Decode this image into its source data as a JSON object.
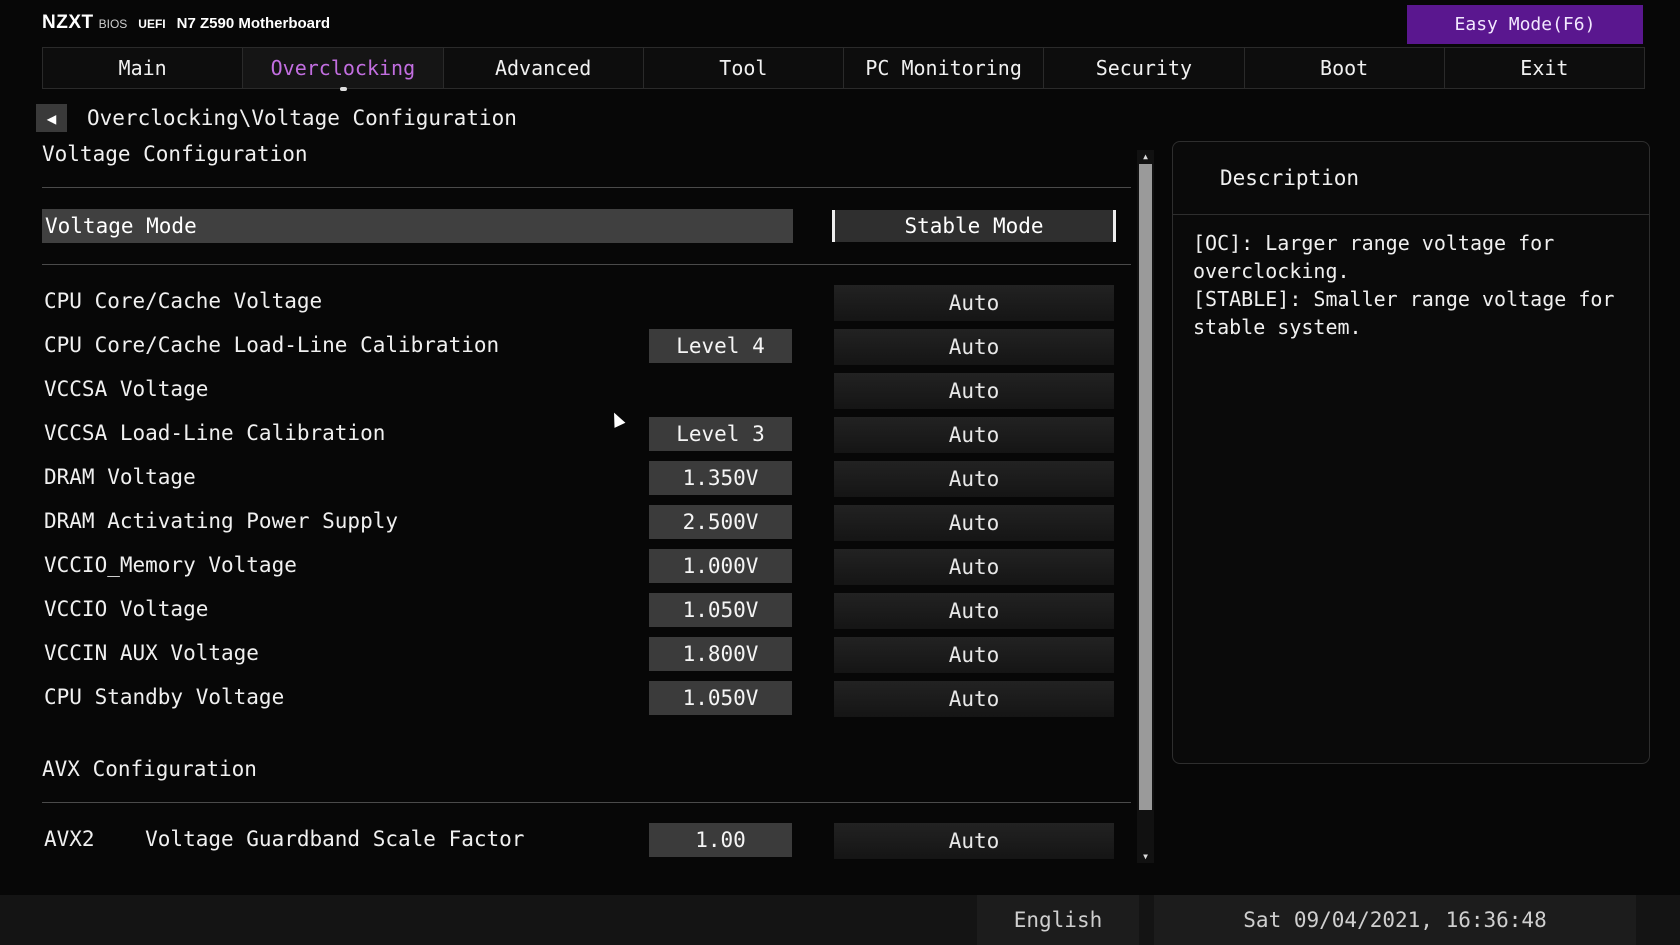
{
  "header": {
    "brand": "NZXT",
    "bios": "BIOS",
    "uefi": "UEFI",
    "model": "N7 Z590 Motherboard",
    "easy_mode": "Easy Mode(F6)"
  },
  "tabs": [
    {
      "label": "Main"
    },
    {
      "label": "Overclocking"
    },
    {
      "label": "Advanced"
    },
    {
      "label": "Tool"
    },
    {
      "label": "PC Monitoring"
    },
    {
      "label": "Security"
    },
    {
      "label": "Boot"
    },
    {
      "label": "Exit"
    }
  ],
  "active_tab": "Overclocking",
  "breadcrumb": "Overclocking\\Voltage Configuration",
  "sections": {
    "voltage": "Voltage Configuration",
    "avx": "AVX Configuration"
  },
  "voltage_mode": {
    "label": "Voltage Mode",
    "value": "Stable Mode"
  },
  "settings": [
    {
      "label": "CPU Core/Cache Voltage",
      "current": "",
      "option": "Auto"
    },
    {
      "label": "CPU Core/Cache Load-Line Calibration",
      "current": "Level 4",
      "option": "Auto"
    },
    {
      "label": "VCCSA Voltage",
      "current": "",
      "option": "Auto"
    },
    {
      "label": "VCCSA Load-Line Calibration",
      "current": "Level 3",
      "option": "Auto"
    },
    {
      "label": "DRAM Voltage",
      "current": "1.350V",
      "option": "Auto"
    },
    {
      "label": "DRAM Activating Power Supply",
      "current": "2.500V",
      "option": "Auto"
    },
    {
      "label": "VCCIO_Memory Voltage",
      "current": "1.000V",
      "option": "Auto"
    },
    {
      "label": "VCCIO Voltage",
      "current": "1.050V",
      "option": "Auto"
    },
    {
      "label": "VCCIN AUX Voltage",
      "current": "1.800V",
      "option": "Auto"
    },
    {
      "label": "CPU Standby Voltage",
      "current": "1.050V",
      "option": "Auto"
    }
  ],
  "avx_settings": [
    {
      "label": "AVX2    Voltage Guardband Scale Factor",
      "current": "1.00",
      "option": "Auto"
    }
  ],
  "description": {
    "title": "Description",
    "lines": [
      "[OC]: Larger range voltage for overclocking.",
      "[STABLE]: Smaller range voltage for stable system."
    ]
  },
  "footer": {
    "language": "English",
    "datetime": "Sat 09/04/2021, 16:36:48"
  }
}
